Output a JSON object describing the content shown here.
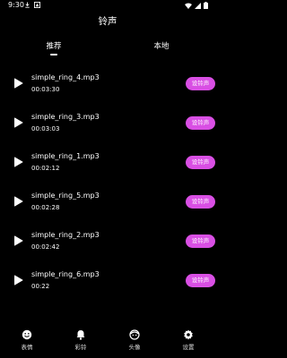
{
  "status_bar": {
    "time": "9:30",
    "icons": [
      "download-icon",
      "notification-icon",
      "wifi-icon",
      "signal-icon",
      "battery-icon"
    ]
  },
  "header": {
    "title": "铃声"
  },
  "tabs": [
    {
      "label": "推荐",
      "selected": true
    },
    {
      "label": "本地",
      "selected": false
    }
  ],
  "ringtones": [
    {
      "name": "simple_ring_4.mp3",
      "duration": "00:03:30",
      "button": "设铃声"
    },
    {
      "name": "simple_ring_3.mp3",
      "duration": "00:03:03",
      "button": "设铃声"
    },
    {
      "name": "simple_ring_1.mp3",
      "duration": "00:02:12",
      "button": "设铃声"
    },
    {
      "name": "simple_ring_5.mp3",
      "duration": "00:02:28",
      "button": "设铃声"
    },
    {
      "name": "simple_ring_2.mp3",
      "duration": "00:02:42",
      "button": "设铃声"
    },
    {
      "name": "simple_ring_6.mp3",
      "duration": "00:22",
      "button": "设铃声"
    }
  ],
  "bottom_nav": [
    {
      "label": "表情",
      "icon": "smiley-icon"
    },
    {
      "label": "彩铃",
      "icon": "bell-icon"
    },
    {
      "label": "头像",
      "icon": "avatar-face-icon"
    },
    {
      "label": "设置",
      "icon": "gear-icon"
    }
  ],
  "colors": {
    "background": "#000000",
    "accent": "#d94fe4",
    "text": "#ffffff"
  }
}
